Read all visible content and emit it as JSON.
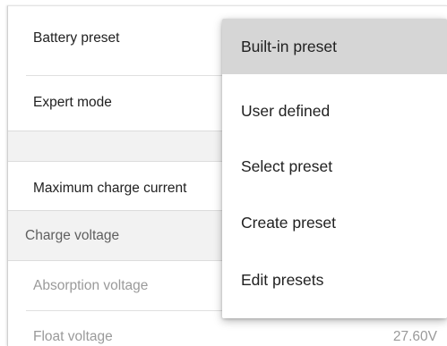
{
  "settings": {
    "battery_preset": "Battery preset",
    "expert_mode": "Expert mode",
    "max_charge_current": "Maximum charge current",
    "charge_voltage_header": "Charge voltage",
    "absorption_voltage": "Absorption voltage",
    "float_voltage": "Float voltage",
    "float_voltage_value": "27.60V"
  },
  "preset_menu": {
    "items": [
      {
        "label": "Built-in preset",
        "highlighted": true
      },
      {
        "label": "User defined"
      },
      {
        "label": "Select preset"
      },
      {
        "label": "Create preset"
      },
      {
        "label": "Edit presets"
      }
    ]
  }
}
